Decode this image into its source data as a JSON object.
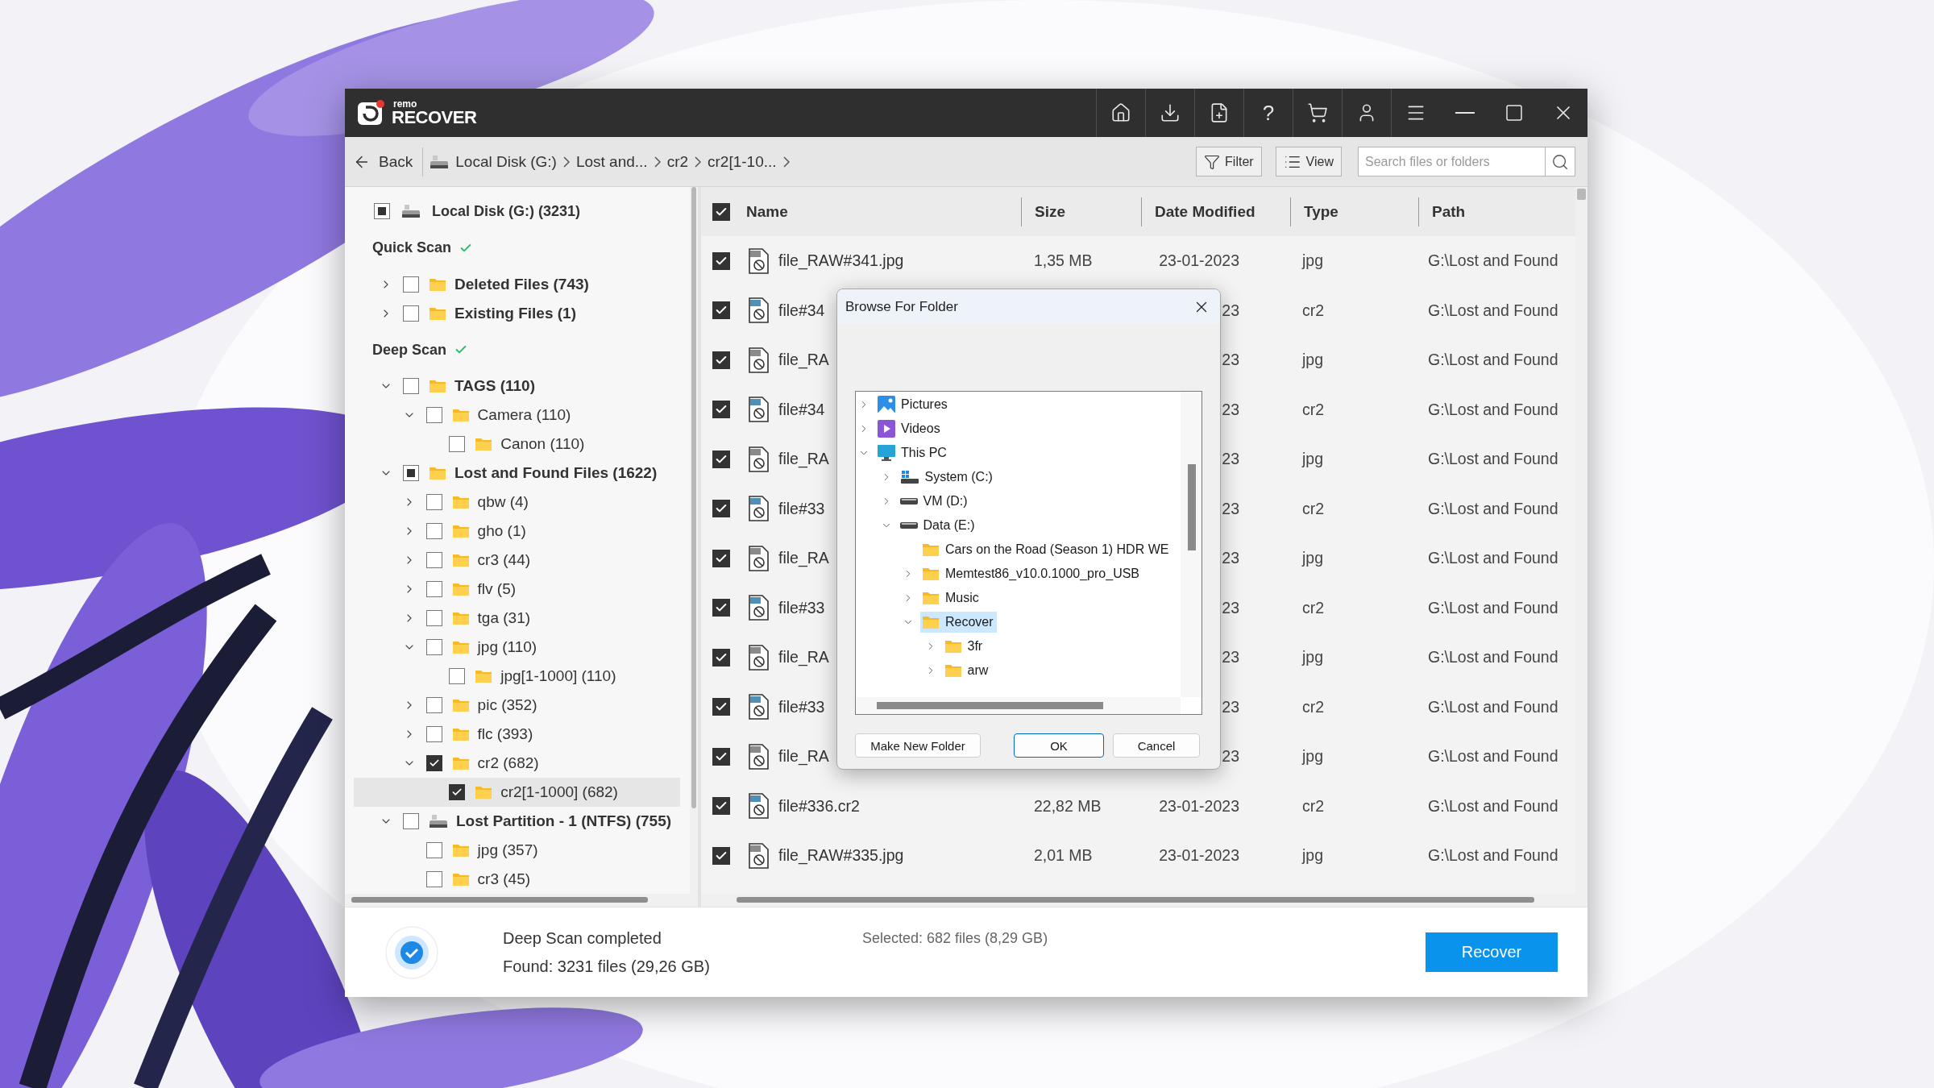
{
  "window": {
    "logo": {
      "small": "remo",
      "main": "RECOVER"
    },
    "toolbar": {
      "help": "?"
    }
  },
  "nav": {
    "back": "Back",
    "breadcrumbs": [
      {
        "label": "Local Disk (G:)",
        "kind": "drive"
      },
      {
        "label": "Lost and...",
        "kind": "plain"
      },
      {
        "label": "cr2",
        "kind": "plain"
      },
      {
        "label": "cr2[1-10...",
        "kind": "plain"
      }
    ],
    "filter": "Filter",
    "view": "View",
    "search": {
      "placeholder": "Search files or folders"
    }
  },
  "tree": {
    "root": {
      "label": "Local Disk (G:) (3231)",
      "checked": false,
      "partial": true
    },
    "sections": [
      {
        "title": "Quick Scan",
        "done": true,
        "items": [
          {
            "label": "Deleted Files (743)",
            "kind": "folder",
            "expanded": false,
            "checked": false,
            "selected": false
          },
          {
            "label": "Existing Files (1)",
            "kind": "folder",
            "expanded": false,
            "checked": false,
            "selected": false
          }
        ]
      },
      {
        "title": "Deep Scan",
        "done": true,
        "items": [
          {
            "label": "TAGS (110)",
            "kind": "folder",
            "expanded": true,
            "checked": false,
            "selected": false,
            "children": [
              {
                "label": "Camera (110)",
                "kind": "folder",
                "expanded": true,
                "checked": false,
                "selected": false,
                "children": [
                  {
                    "label": "Canon (110)",
                    "kind": "folder",
                    "checked": false,
                    "selected": false
                  }
                ]
              }
            ]
          },
          {
            "label": "Lost and Found Files (1622)",
            "kind": "folder",
            "expanded": true,
            "checked": false,
            "partial": true,
            "selected": false,
            "children": [
              {
                "label": "qbw (4)",
                "kind": "folder",
                "expanded": false,
                "checked": false,
                "selected": false
              },
              {
                "label": "gho (1)",
                "kind": "folder",
                "expanded": false,
                "checked": false,
                "selected": false
              },
              {
                "label": "cr3 (44)",
                "kind": "folder",
                "expanded": false,
                "checked": false,
                "selected": false
              },
              {
                "label": "flv (5)",
                "kind": "folder",
                "expanded": false,
                "checked": false,
                "selected": false
              },
              {
                "label": "tga (31)",
                "kind": "folder",
                "expanded": false,
                "checked": false,
                "selected": false
              },
              {
                "label": "jpg (110)",
                "kind": "folder",
                "expanded": true,
                "checked": false,
                "selected": false,
                "children": [
                  {
                    "label": "jpg[1-1000] (110)",
                    "kind": "folder",
                    "checked": false,
                    "selected": false
                  }
                ]
              },
              {
                "label": "pic (352)",
                "kind": "folder",
                "expanded": false,
                "checked": false,
                "selected": false
              },
              {
                "label": "flc (393)",
                "kind": "folder",
                "expanded": false,
                "checked": false,
                "selected": false
              },
              {
                "label": "cr2 (682)",
                "kind": "folder",
                "expanded": true,
                "checked": true,
                "selected": false,
                "children": [
                  {
                    "label": "cr2[1-1000] (682)",
                    "kind": "folder",
                    "checked": true,
                    "selected": true
                  }
                ]
              }
            ]
          },
          {
            "label": "Lost Partition - 1 (NTFS) (755)",
            "kind": "drive",
            "expanded": true,
            "checked": false,
            "selected": false,
            "children": [
              {
                "label": "jpg (357)",
                "kind": "folder",
                "checked": false,
                "selected": false
              },
              {
                "label": "cr3 (45)",
                "kind": "folder",
                "checked": false,
                "selected": false
              }
            ]
          }
        ]
      }
    ]
  },
  "table": {
    "columns": [
      "Name",
      "Size",
      "Date Modified",
      "Type",
      "Path"
    ],
    "all_checked": true,
    "rows": [
      {
        "checked": true,
        "color": "#8a8a8a",
        "name": "file_RAW#341.jpg",
        "size": "1,35 MB",
        "date": "23-01-2023",
        "type": "jpg",
        "path": "G:\\Lost and Found"
      },
      {
        "checked": true,
        "color": "#4f8fb8",
        "name": "file#34",
        "date": "23",
        "type": "cr2",
        "path": "G:\\Lost and Found"
      },
      {
        "checked": true,
        "color": "#8a8a8a",
        "name": "file_RA",
        "date": "23",
        "type": "jpg",
        "path": "G:\\Lost and Found"
      },
      {
        "checked": true,
        "color": "#4f8fb8",
        "name": "file#34",
        "date": "23",
        "type": "cr2",
        "path": "G:\\Lost and Found"
      },
      {
        "checked": true,
        "color": "#8a8a8a",
        "name": "file_RA",
        "date": "23",
        "type": "jpg",
        "path": "G:\\Lost and Found"
      },
      {
        "checked": true,
        "color": "#4f8fb8",
        "name": "file#33",
        "date": "23",
        "type": "cr2",
        "path": "G:\\Lost and Found"
      },
      {
        "checked": true,
        "color": "#8a8a8a",
        "name": "file_RA",
        "date": "23",
        "type": "jpg",
        "path": "G:\\Lost and Found"
      },
      {
        "checked": true,
        "color": "#4f8fb8",
        "name": "file#33",
        "date": "23",
        "type": "cr2",
        "path": "G:\\Lost and Found"
      },
      {
        "checked": true,
        "color": "#8a8a8a",
        "name": "file_RA",
        "date": "23",
        "type": "jpg",
        "path": "G:\\Lost and Found"
      },
      {
        "checked": true,
        "color": "#4f8fb8",
        "name": "file#33",
        "date": "23",
        "type": "cr2",
        "path": "G:\\Lost and Found"
      },
      {
        "checked": true,
        "color": "#8a8a8a",
        "name": "file_RA",
        "date": "23",
        "type": "jpg",
        "path": "G:\\Lost and Found"
      },
      {
        "checked": true,
        "color": "#4f8fb8",
        "name": "file#336.cr2",
        "size": "22,82 MB",
        "date": "23-01-2023",
        "type": "cr2",
        "path": "G:\\Lost and Found"
      },
      {
        "checked": true,
        "color": "#8a8a8a",
        "name": "file_RAW#335.jpg",
        "size": "2,01 MB",
        "date": "23-01-2023",
        "type": "jpg",
        "path": "G:\\Lost and Found"
      }
    ]
  },
  "dialog": {
    "title": "Browse For Folder",
    "items": [
      {
        "label": "Pictures",
        "kind": "pictures",
        "expanded": false,
        "selected": false
      },
      {
        "label": "Videos",
        "kind": "videos",
        "expanded": false,
        "selected": false
      },
      {
        "label": "This PC",
        "kind": "pc",
        "expanded": true,
        "selected": false,
        "children": [
          {
            "label": "System (C:)",
            "kind": "system",
            "expanded": false,
            "selected": false
          },
          {
            "label": "VM (D:)",
            "kind": "drive",
            "expanded": false,
            "selected": false
          },
          {
            "label": "Data (E:)",
            "kind": "drive",
            "expanded": true,
            "selected": false,
            "children": [
              {
                "label": "Cars on the Road (Season 1) HDR WE",
                "kind": "folder",
                "selected": false
              },
              {
                "label": "Memtest86_v10.0.1000_pro_USB",
                "kind": "folder",
                "expanded": false,
                "selected": false
              },
              {
                "label": "Music",
                "kind": "folder",
                "expanded": false,
                "selected": false
              },
              {
                "label": "Recover",
                "kind": "folder",
                "expanded": true,
                "selected": true,
                "children": [
                  {
                    "label": "3fr",
                    "kind": "folder",
                    "expanded": false,
                    "selected": false
                  },
                  {
                    "label": "arw",
                    "kind": "folder",
                    "expanded": false,
                    "selected": false
                  }
                ]
              }
            ]
          }
        ]
      }
    ],
    "buttons": [
      {
        "label": "Make New Folder",
        "default": false
      },
      {
        "label": "OK",
        "default": true
      },
      {
        "label": "Cancel",
        "default": false
      }
    ]
  },
  "status": {
    "done": true,
    "title": "Deep Scan completed",
    "found": "Found: 3231 files (29,26 GB)",
    "selected": "Selected: 682 files (8,29 GB)",
    "button": "Recover"
  }
}
